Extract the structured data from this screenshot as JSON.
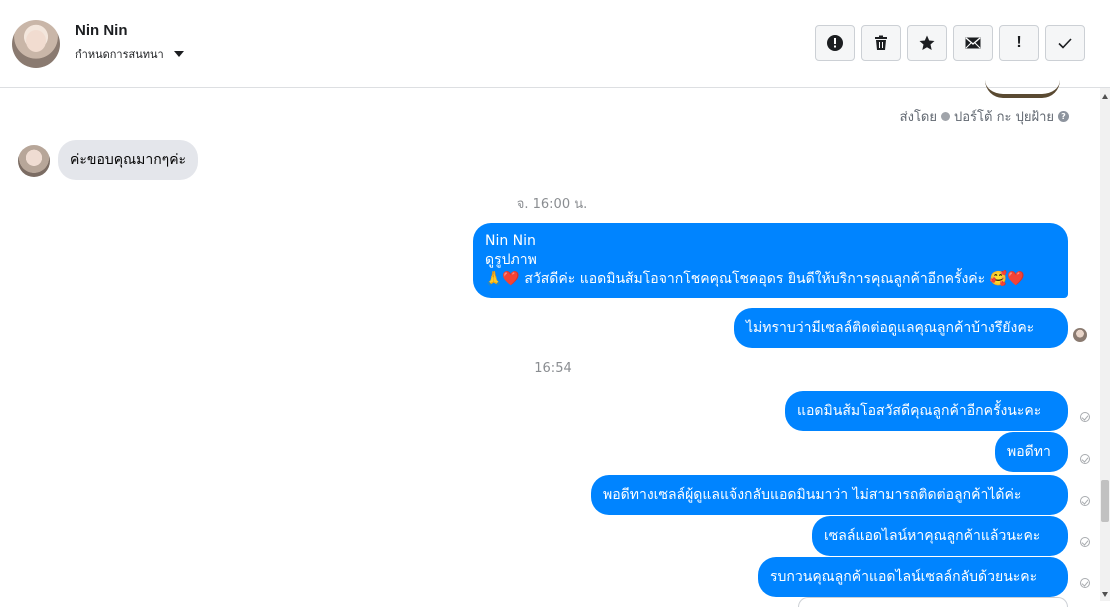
{
  "header": {
    "contact_name": "Nin Nin",
    "assign_label": "กำหนดการสนทนา",
    "toolbar": [
      {
        "name": "spam-button",
        "icon": "alert-circle-icon"
      },
      {
        "name": "delete-button",
        "icon": "trash-icon"
      },
      {
        "name": "star-button",
        "icon": "star-icon"
      },
      {
        "name": "mark-unread-button",
        "icon": "envelope-icon"
      },
      {
        "name": "priority-button",
        "icon": "exclamation-icon",
        "text": "!"
      },
      {
        "name": "done-button",
        "icon": "check-icon"
      }
    ]
  },
  "conversation": {
    "sent_by": {
      "prefix": "ส่งโดย",
      "name": "ปอร์โต้ กะ ปุยฝ้าย"
    },
    "received": {
      "text": "ค่ะขอบคุณมากๆค่ะ"
    },
    "timestamps": [
      "จ. 16:00 น.",
      "16:54"
    ],
    "sent_messages": [
      {
        "lines": [
          "Nin Nin",
          "ดูรูปภาพ",
          "🙏❤️ สวัสดีค่ะ แอดมินส้มโอจากโชคคุณโชคอุดร ยินดีให้บริการคุณลูกค้าอีกครั้งค่ะ 🥰❤️"
        ]
      },
      {
        "lines": [
          "ไม่ทราบว่ามีเซลล์ติดต่อดูแลคุณลูกค้าบ้างรึยังคะ"
        ]
      },
      {
        "lines": [
          "แอดมินส้มโอสวัสดีคุณลูกค้าอีกครั้งนะคะ"
        ]
      },
      {
        "lines": [
          "พอดีทา"
        ]
      },
      {
        "lines": [
          "พอดีทางเซลล์ผู้ดูแลแจ้งกลับแอดมินมาว่า ไม่สามารถติดต่อลูกค้าได้ค่ะ"
        ]
      },
      {
        "lines": [
          "เซลล์แอดไลน์หาคุณลูกค้าแล้วนะคะ"
        ]
      },
      {
        "lines": [
          "รบกวนคุณลูกค้าแอดไลน์เซลล์กลับด้วยนะคะ"
        ]
      }
    ],
    "help_glyph": "?"
  },
  "colors": {
    "sent_bubble": "#0084ff",
    "received_bubble": "#e4e6eb",
    "timestamp": "#8a8d91"
  }
}
